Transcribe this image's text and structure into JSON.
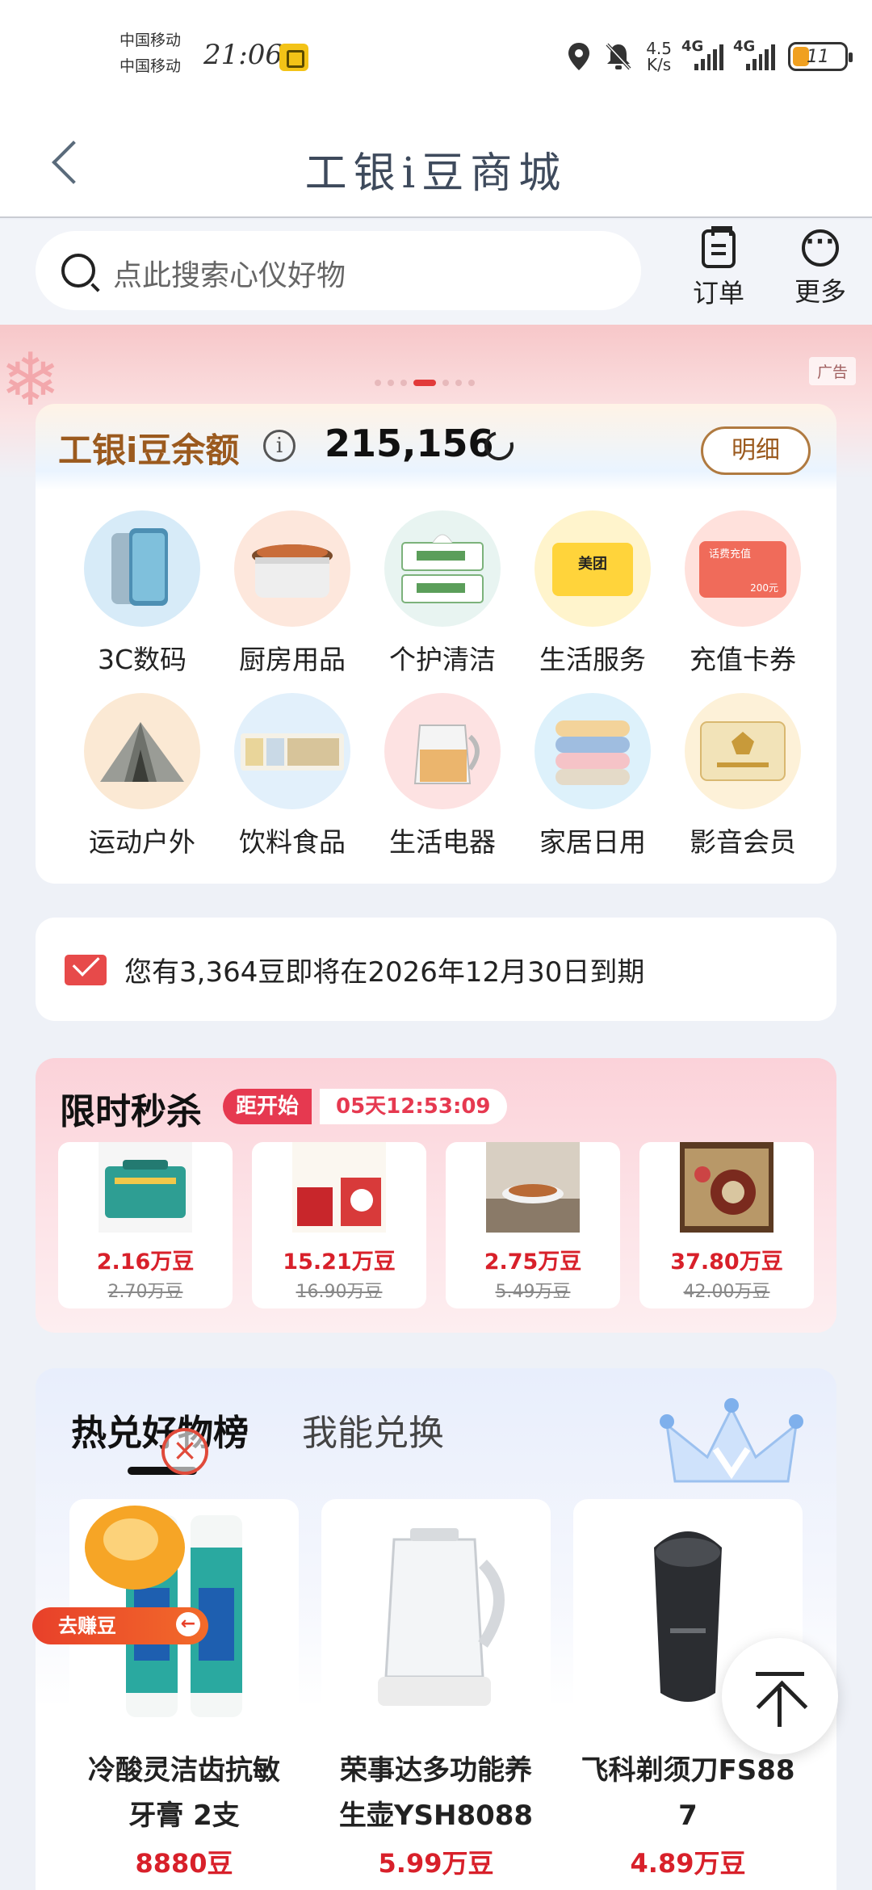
{
  "status_bar": {
    "carrier1": "中国移动",
    "carrier2": "中国移动",
    "time": "21:06",
    "net_speed": "4.5",
    "net_unit": "K/s",
    "sig1": "4G",
    "sig2": "4G",
    "battery": "11"
  },
  "header": {
    "title": "工银i豆商城"
  },
  "search": {
    "placeholder": "点此搜索心仪好物",
    "order_label": "订单",
    "more_label": "更多"
  },
  "banner": {
    "ad_label": "广告"
  },
  "balance": {
    "title": "工银i豆余额",
    "value": "215,156",
    "detail_label": "明细"
  },
  "categories": [
    {
      "label": "3C数码",
      "icon": "phone"
    },
    {
      "label": "厨房用品",
      "icon": "cooker"
    },
    {
      "label": "个护清洁",
      "icon": "tissue"
    },
    {
      "label": "生活服务",
      "icon": "meituan-card",
      "card_text": "美团"
    },
    {
      "label": "充值卡券",
      "icon": "topup-card",
      "card_text": "话费充值",
      "card_value": "200元"
    },
    {
      "label": "运动户外",
      "icon": "tent"
    },
    {
      "label": "饮料食品",
      "icon": "drinks"
    },
    {
      "label": "生活电器",
      "icon": "kettle"
    },
    {
      "label": "家居日用",
      "icon": "towels"
    },
    {
      "label": "影音会员",
      "icon": "iqiyi-card"
    }
  ],
  "expiry": {
    "text": "您有3,364豆即将在2026年12月30日到期"
  },
  "flash_sale": {
    "title": "限时秒杀",
    "countdown_label": "距开始",
    "countdown": "05天12:53:09",
    "items": [
      {
        "price": "2.16万豆",
        "original": "2.70万豆",
        "color": "#2e9e93"
      },
      {
        "price": "15.21万豆",
        "original": "16.90万豆",
        "color": "#c8262b"
      },
      {
        "price": "2.75万豆",
        "original": "5.49万豆",
        "color": "#8a7a68"
      },
      {
        "price": "37.80万豆",
        "original": "42.00万豆",
        "color": "#5b3a22"
      }
    ]
  },
  "hot": {
    "tab1": "热兑好物榜",
    "tab2": "我能兑换",
    "products": [
      {
        "name_line1": "冷酸灵洁齿抗敏",
        "name_line2": "牙膏 2支",
        "price": "8880豆"
      },
      {
        "name_line1": "荣事达多功能养",
        "name_line2": "生壶YSH8088",
        "price": "5.99万豆"
      },
      {
        "name_line1": "飞科剃须刀FS88",
        "name_line2": "7",
        "price": "4.89万豆"
      }
    ]
  },
  "floating": {
    "promo_label": "去赚豆"
  },
  "colors": {
    "accent_red": "#d8202a",
    "balance_brown": "#9b5a1e"
  }
}
